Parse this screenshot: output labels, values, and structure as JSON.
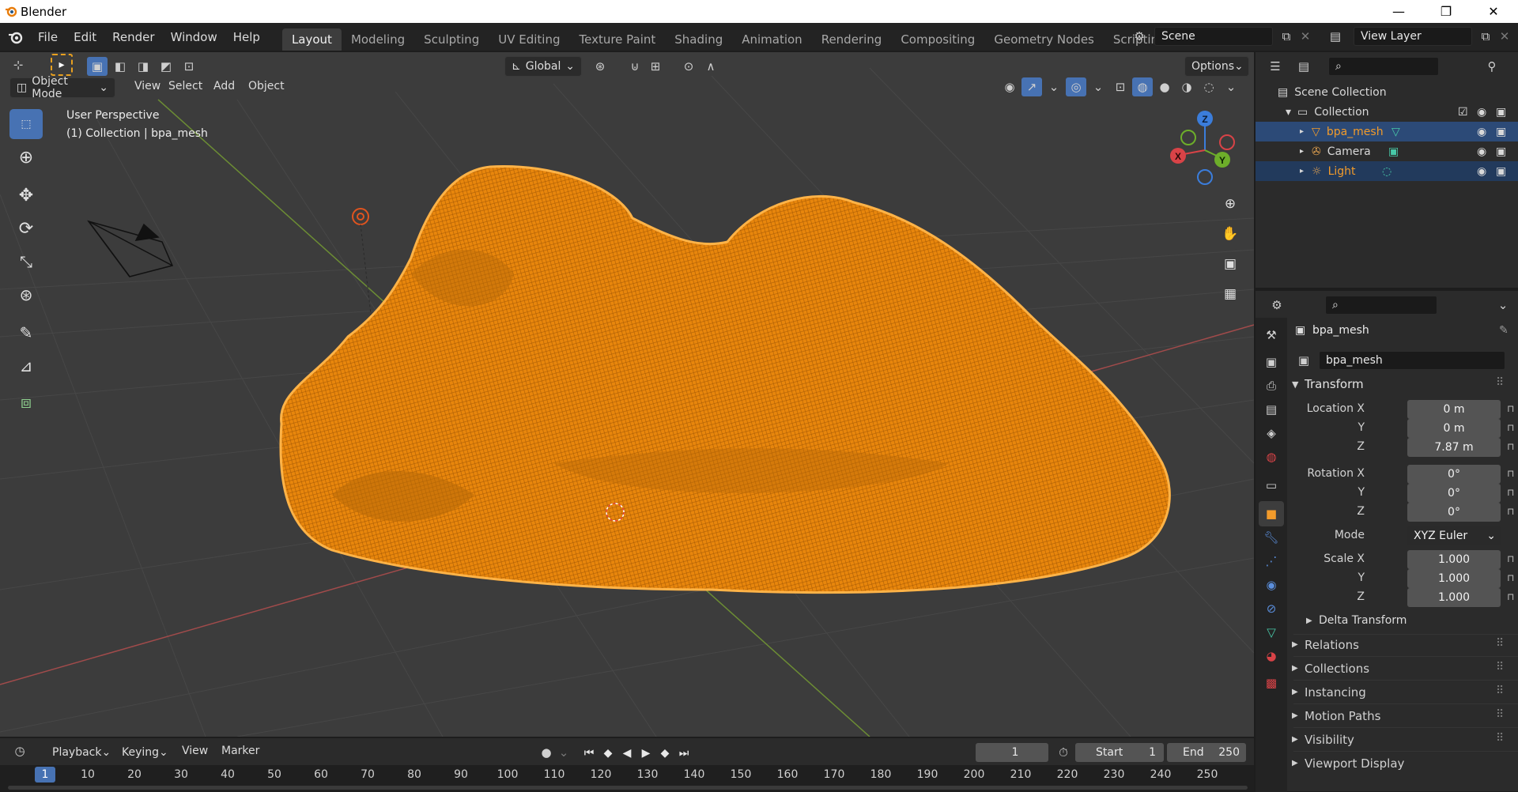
{
  "window": {
    "title": "Blender",
    "minimize": "—",
    "maximize": "❐",
    "close": "✕"
  },
  "menus": [
    "File",
    "Edit",
    "Render",
    "Window",
    "Help"
  ],
  "workspaces": [
    "Layout",
    "Modeling",
    "Sculpting",
    "UV Editing",
    "Texture Paint",
    "Shading",
    "Animation",
    "Rendering",
    "Compositing",
    "Geometry Nodes",
    "Scripting"
  ],
  "add_workspace": "+",
  "scene": {
    "label": "Scene",
    "view_layer": "View Layer"
  },
  "viewport": {
    "transform_orientation": "Global",
    "options": "Options",
    "mode": "Object Mode",
    "menus": [
      "View",
      "Select",
      "Add",
      "Object"
    ],
    "perspective": "User Perspective",
    "collection_info": "(1) Collection | bpa_mesh",
    "axes": {
      "x": "X",
      "y": "Y",
      "z": "Z"
    }
  },
  "outliner": {
    "root": "Scene Collection",
    "collection": "Collection",
    "items": [
      {
        "label": "bpa_mesh",
        "color": "#f29b2b",
        "selected": true
      },
      {
        "label": "Camera",
        "color": "#d8d8d8",
        "selected": false
      },
      {
        "label": "Light",
        "color": "#f29b2b",
        "selected": true
      }
    ]
  },
  "properties": {
    "object_name": "bpa_mesh",
    "datablock": "bpa_mesh",
    "transform_title": "Transform",
    "location": {
      "label": "Location X",
      "x": "0 m",
      "y": "0 m",
      "z": "7.87 m"
    },
    "rotation": {
      "label": "Rotation X",
      "x": "0°",
      "y": "0°",
      "z": "0°"
    },
    "mode": {
      "label": "Mode",
      "value": "XYZ Euler"
    },
    "scale": {
      "label": "Scale X",
      "x": "1.000",
      "y": "1.000",
      "z": "1.000"
    },
    "axis_y": "Y",
    "axis_z": "Z",
    "delta": "Delta Transform",
    "panels": [
      "Relations",
      "Collections",
      "Instancing",
      "Motion Paths",
      "Visibility",
      "Viewport Display"
    ]
  },
  "timeline": {
    "menus": [
      "Playback",
      "Keying",
      "View",
      "Marker"
    ],
    "current_frame": "1",
    "start_label": "Start",
    "start": "1",
    "end_label": "End",
    "end": "250",
    "ruler": [
      "1",
      "10",
      "20",
      "30",
      "40",
      "50",
      "60",
      "70",
      "80",
      "90",
      "100",
      "110",
      "120",
      "130",
      "140",
      "150",
      "160",
      "170",
      "180",
      "190",
      "200",
      "210",
      "220",
      "230",
      "240",
      "250"
    ]
  },
  "colors": {
    "accent": "#4772b3",
    "selection": "#f29b2b",
    "header": "#232323",
    "viewport": "#3c3c3c"
  }
}
